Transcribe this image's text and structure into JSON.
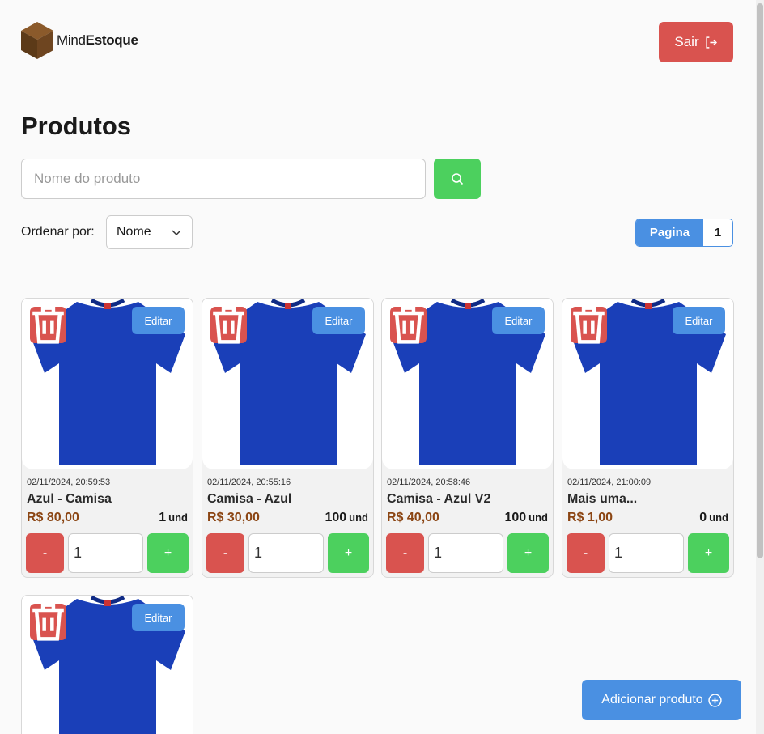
{
  "header": {
    "logo_text_regular": "Mind",
    "logo_text_bold": "Estoque",
    "logout_label": "Sair"
  },
  "page": {
    "title": "Produtos"
  },
  "search": {
    "placeholder": "Nome do produto",
    "value": ""
  },
  "sort": {
    "label": "Ordenar por:",
    "selected": "Nome"
  },
  "pagination": {
    "label": "Pagina",
    "current": "1"
  },
  "products": [
    {
      "date": "02/11/2024, 20:59:53",
      "name": "Azul - Camisa",
      "price": "R$ 80,00",
      "stock": "1",
      "unit": "und",
      "qty_input": "1"
    },
    {
      "date": "02/11/2024, 20:55:16",
      "name": "Camisa - Azul",
      "price": "R$ 30,00",
      "stock": "100",
      "unit": "und",
      "qty_input": "1"
    },
    {
      "date": "02/11/2024, 20:58:46",
      "name": "Camisa - Azul V2",
      "price": "R$ 40,00",
      "stock": "100",
      "unit": "und",
      "qty_input": "1"
    },
    {
      "date": "02/11/2024, 21:00:09",
      "name": "Mais uma...",
      "price": "R$ 1,00",
      "stock": "0",
      "unit": "und",
      "qty_input": "1"
    }
  ],
  "card_labels": {
    "edit": "Editar",
    "minus": "-",
    "plus": "+"
  },
  "add_product_label": "Adicionar produto",
  "colors": {
    "primary": "#4a90e2",
    "danger": "#d9534f",
    "success": "#4cd05e",
    "price": "#8b4513",
    "shirt": "#1a3fb8"
  }
}
